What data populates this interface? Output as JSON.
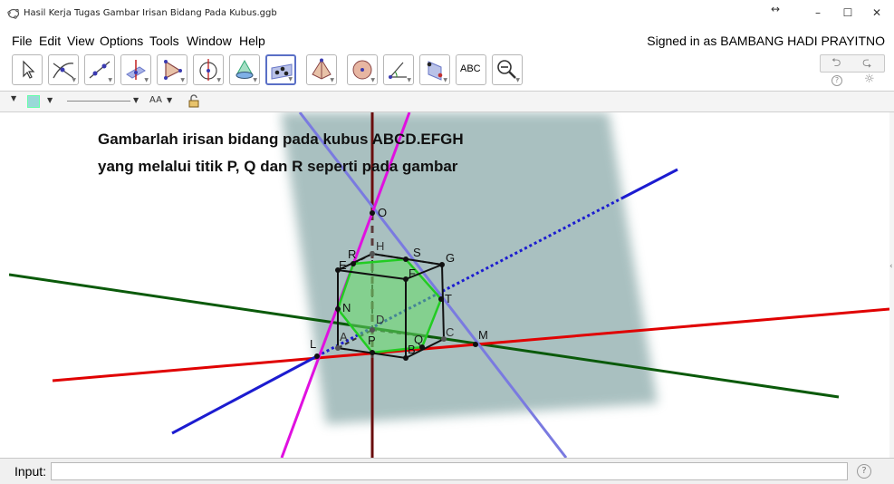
{
  "window": {
    "title": "Hasil Kerja Tugas Gambar Irisan Bidang Pada Kubus.ggb",
    "resize_glyph": "↔",
    "minimize": "–",
    "maximize": "☐",
    "close": "✕"
  },
  "menu": {
    "items": [
      "File",
      "Edit",
      "View",
      "Options",
      "Tools",
      "Window",
      "Help"
    ],
    "signed_in": "Signed in as BAMBANG HADI PRAYITNO"
  },
  "toolbar": {
    "tools": [
      "move-tool",
      "intersect-tool",
      "line-tool",
      "perpendicular-tool",
      "polygon-tool",
      "circle-axis-tool",
      "cone-tool",
      "plane-tool",
      "pyramid-tool",
      "sphere-tool",
      "angle-tool",
      "reflect-tool",
      "text-tool",
      "zoom-tool"
    ],
    "text_tool_label": "ABC",
    "selected": "plane-tool",
    "undo": "⮌",
    "redo": "⮎",
    "help": "?",
    "settings": "☼"
  },
  "stylebar": {
    "font_size_label": "AA"
  },
  "canvas": {
    "instruction_line1": "Gambarlah irisan bidang pada kubus ABCD.EFGH",
    "instruction_line2": "yang melalui titik P, Q dan R seperti pada gambar",
    "points": [
      "O",
      "H",
      "R",
      "S",
      "G",
      "E",
      "F",
      "T",
      "N",
      "D",
      "A",
      "C",
      "M",
      "L",
      "P",
      "Q",
      "B"
    ],
    "colors": {
      "green_line": "#0a5a0a",
      "red_line": "#e00000",
      "blue_line": "#1c1cd0",
      "magenta_line": "#e010e0",
      "lilac_line": "#7a7ae0",
      "section": "#66dd66",
      "plane": "#7a9e9e"
    }
  },
  "input": {
    "label": "Input:",
    "value": "",
    "help": "?"
  }
}
